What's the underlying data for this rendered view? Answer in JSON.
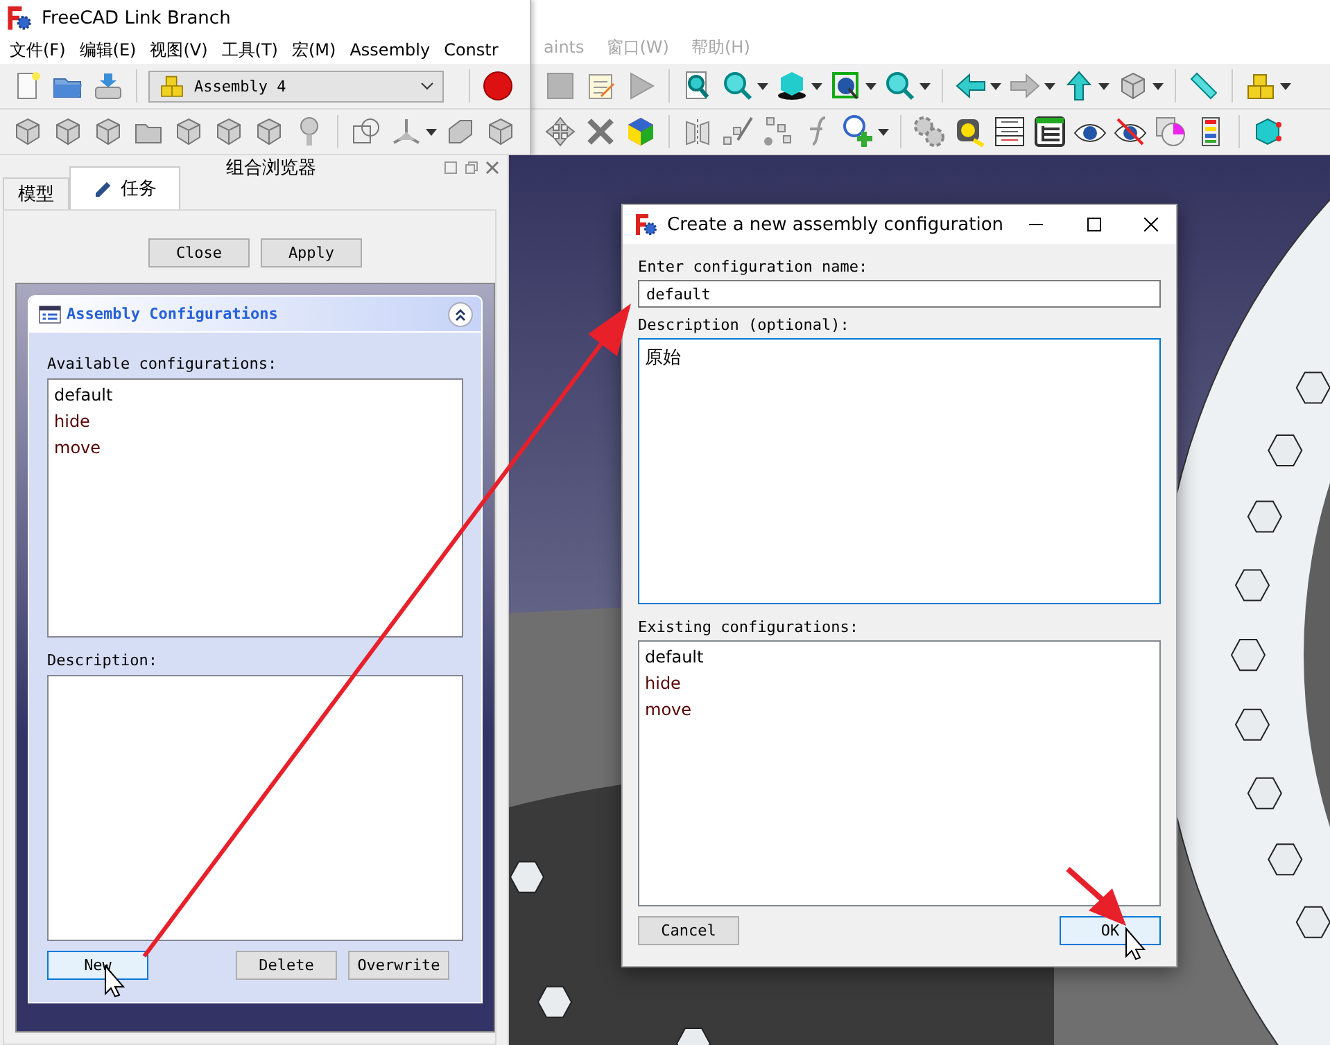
{
  "background_window": {
    "menu": [
      "aints",
      "窗口(W)",
      "帮助(H)"
    ]
  },
  "window": {
    "title": "FreeCAD Link Branch",
    "menu": [
      "文件(F)",
      "编辑(E)",
      "视图(V)",
      "工具(T)",
      "宏(M)",
      "Assembly",
      "Constr"
    ],
    "workbench": "Assembly 4"
  },
  "combo_view": {
    "title": "组合浏览器",
    "tabs": [
      {
        "label": "模型",
        "selected": false
      },
      {
        "label": "任务",
        "selected": true
      }
    ],
    "buttons": [
      "Close",
      "Apply"
    ],
    "panel": {
      "title": "Assembly Configurations",
      "available_label": "Available configurations:",
      "configurations": [
        "default",
        "hide",
        "move"
      ],
      "description_label": "Description:",
      "buttons": [
        {
          "label": "New",
          "focused": true
        },
        {
          "label": "Delete",
          "focused": false
        },
        {
          "label": "Overwrite",
          "focused": false
        }
      ]
    }
  },
  "dialog": {
    "title": "Create a new assembly configuration",
    "name_label": "Enter configuration name:",
    "name_value": "default",
    "description_label": "Description (optional):",
    "description_value": "原始",
    "existing_label": "Existing configurations:",
    "existing": [
      "default",
      "hide",
      "move"
    ],
    "buttons": [
      {
        "label": "Cancel",
        "focused": false
      },
      {
        "label": "OK",
        "focused": true
      }
    ]
  }
}
